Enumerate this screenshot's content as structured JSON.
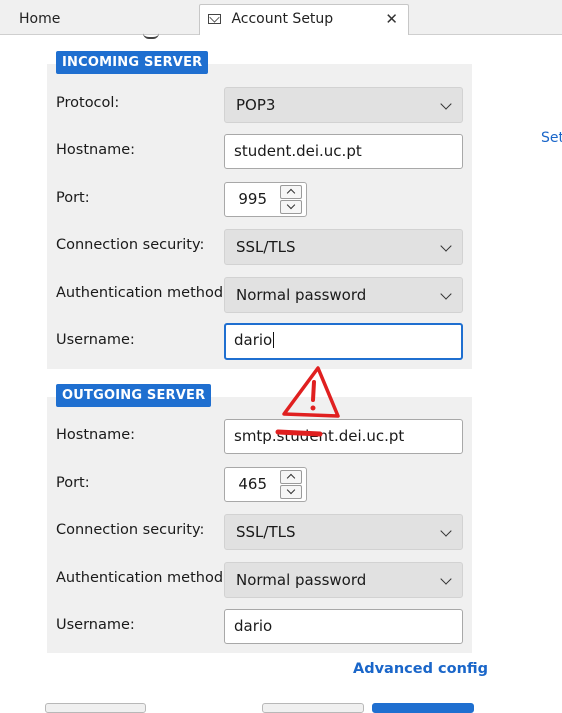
{
  "tabs": {
    "home_label": "Home",
    "account_setup_label": "Account Setup",
    "close_label": "✕"
  },
  "right_link": "Set",
  "incoming": {
    "section_title": "INCOMING SERVER",
    "protocol_label": "Protocol:",
    "protocol_value": "POP3",
    "hostname_label": "Hostname:",
    "hostname_value": "student.dei.uc.pt",
    "port_label": "Port:",
    "port_value": "995",
    "security_label": "Connection security:",
    "security_value": "SSL/TLS",
    "auth_label": "Authentication method:",
    "auth_value": "Normal password",
    "username_label": "Username:",
    "username_value": "dario"
  },
  "outgoing": {
    "section_title": "OUTGOING SERVER",
    "hostname_label": "Hostname:",
    "hostname_value": "smtp.student.dei.uc.pt",
    "port_label": "Port:",
    "port_value": "465",
    "security_label": "Connection security:",
    "security_value": "SSL/TLS",
    "auth_label": "Authentication method:",
    "auth_value": "Normal password",
    "username_label": "Username:",
    "username_value": "dario"
  },
  "advanced_link": "Advanced config",
  "annotation": {
    "icon": "warning-triangle-icon",
    "color": "#e02020"
  },
  "colors": {
    "accent": "#1f6fd0",
    "link": "#1a66c9",
    "panel": "#f0f0f0"
  }
}
